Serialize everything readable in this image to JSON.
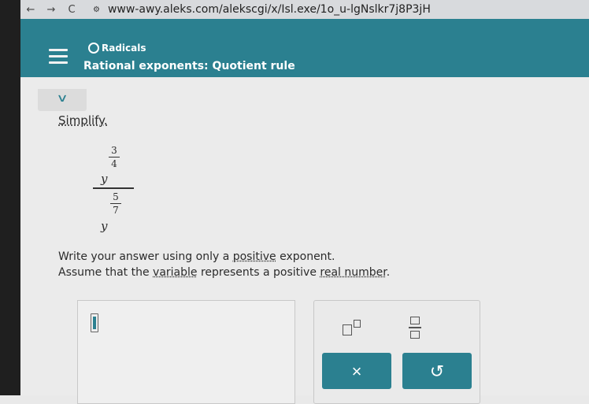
{
  "browser": {
    "back_icon": "←",
    "forward_icon": "→",
    "reload_icon": "C",
    "site_info_icon": "⚙",
    "url": "www-awy.aleks.com/alekscgi/x/Isl.exe/1o_u-lgNslkr7j8P3jH"
  },
  "header": {
    "topic": "Radicals",
    "title": "Rational exponents: Quotient rule"
  },
  "problem": {
    "collapse_icon": "∨",
    "instruction": "Simplify.",
    "numerator": {
      "base": "y",
      "exp_num": "3",
      "exp_den": "4"
    },
    "denominator": {
      "base": "y",
      "exp_num": "5",
      "exp_den": "7"
    },
    "note1_prefix": "Write your answer using only a ",
    "note1_link": "positive",
    "note1_suffix": " exponent.",
    "note2_prefix": "Assume that the ",
    "note2_link1": "variable",
    "note2_mid": " represents a positive ",
    "note2_link2": "real number",
    "note2_suffix": "."
  },
  "keypad": {
    "clear_label": "×",
    "undo_label": "↺"
  },
  "colors": {
    "accent": "#2b8090",
    "background": "#ebebeb"
  }
}
